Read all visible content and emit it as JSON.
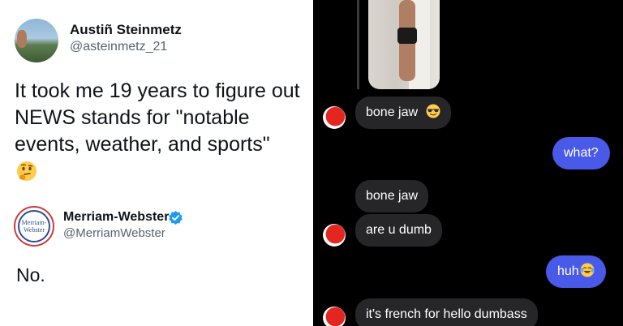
{
  "tweet": {
    "author_name": "Austiñ Steinmetz",
    "author_handle": "@asteinmetz_21",
    "text": "It took me 19 years to figure out NEWS stands for \"notable events, weather, and sports\"",
    "emoji": "thinking-face"
  },
  "reply": {
    "author_name": "Merriam-Webster",
    "author_handle": "@MerriamWebster",
    "avatar_text": "Merriam-Webster",
    "verified": true,
    "text": "No."
  },
  "chat": {
    "messages": [
      {
        "direction": "incoming",
        "text": "bone jaw",
        "emoji": "sunglasses-face"
      },
      {
        "direction": "outgoing",
        "text": "what?"
      },
      {
        "direction": "incoming",
        "text": "bone jaw"
      },
      {
        "direction": "incoming",
        "text": "are u dumb"
      },
      {
        "direction": "outgoing",
        "text": "huh",
        "emoji": "crying-laughing-face"
      },
      {
        "direction": "incoming",
        "text": "it's french for hello dumbass"
      }
    ]
  },
  "colors": {
    "outgoing_bubble": "#4a5ae8",
    "incoming_bubble": "#262628",
    "verified_badge": "#1d9bf0"
  }
}
